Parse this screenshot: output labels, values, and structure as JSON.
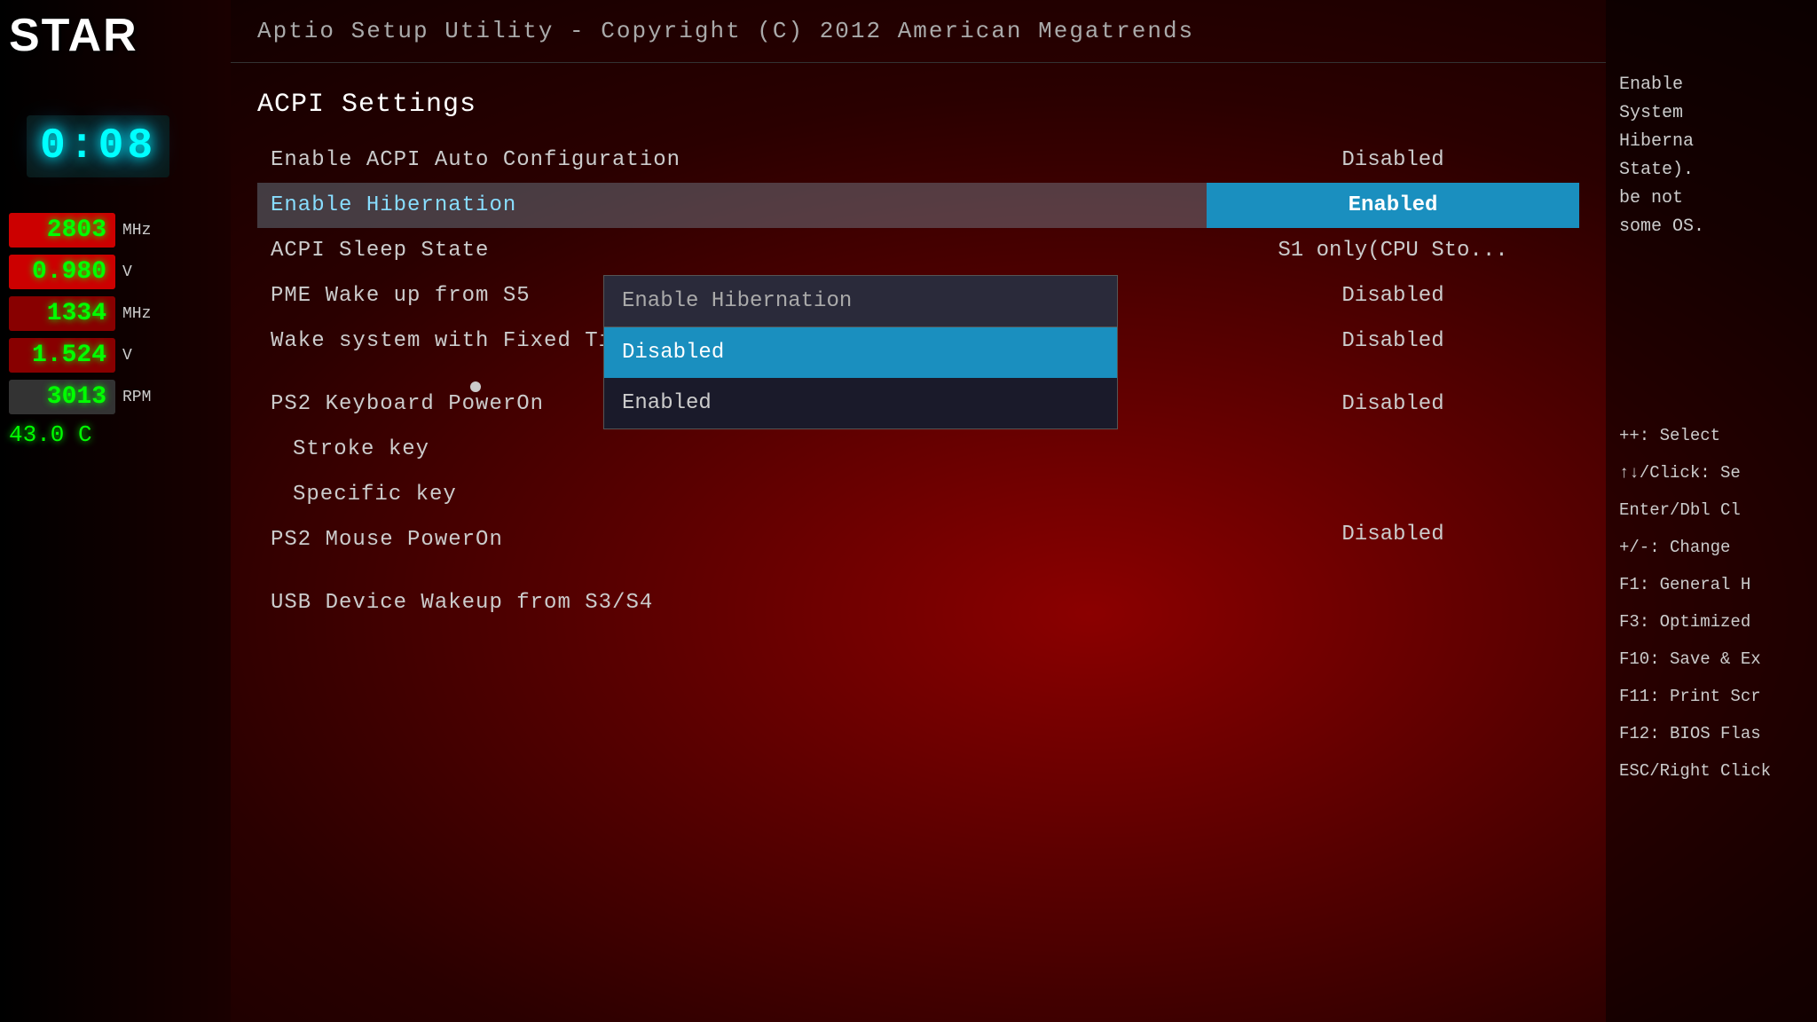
{
  "header": {
    "title": "Aptio Setup Utility - Copyright (C) 2012 American Megatrends"
  },
  "logo": {
    "text": "STAR"
  },
  "clock": {
    "time": "0:08"
  },
  "stats": [
    {
      "value": "2803",
      "unit": "MHz",
      "class": "stat-cpu-mhz"
    },
    {
      "value": "0.980",
      "unit": "V",
      "class": "stat-cpu-v"
    },
    {
      "value": "1334",
      "unit": "MHz",
      "class": "stat-ram-mhz"
    },
    {
      "value": "1.524",
      "unit": "V",
      "class": "stat-ram-v"
    },
    {
      "value": "3013",
      "unit": "RPM",
      "class": "stat-rpm"
    },
    {
      "value": "43.0 C",
      "unit": "",
      "class": "stat-temp"
    }
  ],
  "section": {
    "title": "ACPI Settings"
  },
  "settings": [
    {
      "label": "Enable ACPI Auto Configuration",
      "value": "Disabled",
      "selected": false
    },
    {
      "label": "Enable Hibernation",
      "value": "Enabled",
      "selected": true,
      "value_class": "enabled-blue"
    },
    {
      "label": "ACPI Sleep State",
      "value": "S1 only(CPU Sto...",
      "selected": false
    },
    {
      "label": "PME Wake up from S5",
      "value": "Disabled",
      "selected": false
    },
    {
      "label": "Wake system with Fixed Time",
      "value": "Disabled",
      "selected": false
    },
    {
      "label": "PS2 Keyboard PowerOn",
      "value": "Disabled",
      "selected": false
    },
    {
      "label": "Stroke key",
      "value": "",
      "selected": false
    },
    {
      "label": "Specific key",
      "value": "",
      "selected": false
    },
    {
      "label": "PS2 Mouse PowerOn",
      "value": "Disabled",
      "selected": false
    },
    {
      "label": "USB Device Wakeup from S3/S4",
      "value": "",
      "selected": false
    }
  ],
  "dropdown": {
    "header": "Enable Hibernation",
    "options": [
      {
        "label": "Disabled",
        "selected": true
      },
      {
        "label": "Enabled",
        "selected": false
      }
    ]
  },
  "help": {
    "description": "Enable System Hibernation State). It may be not supported by some OS.",
    "keys": [
      "++: Select",
      "↑↓/Click: Se",
      "Enter/Dbl Cl",
      "+/-: Change",
      "F1: General H",
      "F3: Optimized",
      "F10: Save & Ex",
      "F11: Print Scr",
      "F12: BIOS Flas",
      "ESC/Right Click"
    ]
  }
}
